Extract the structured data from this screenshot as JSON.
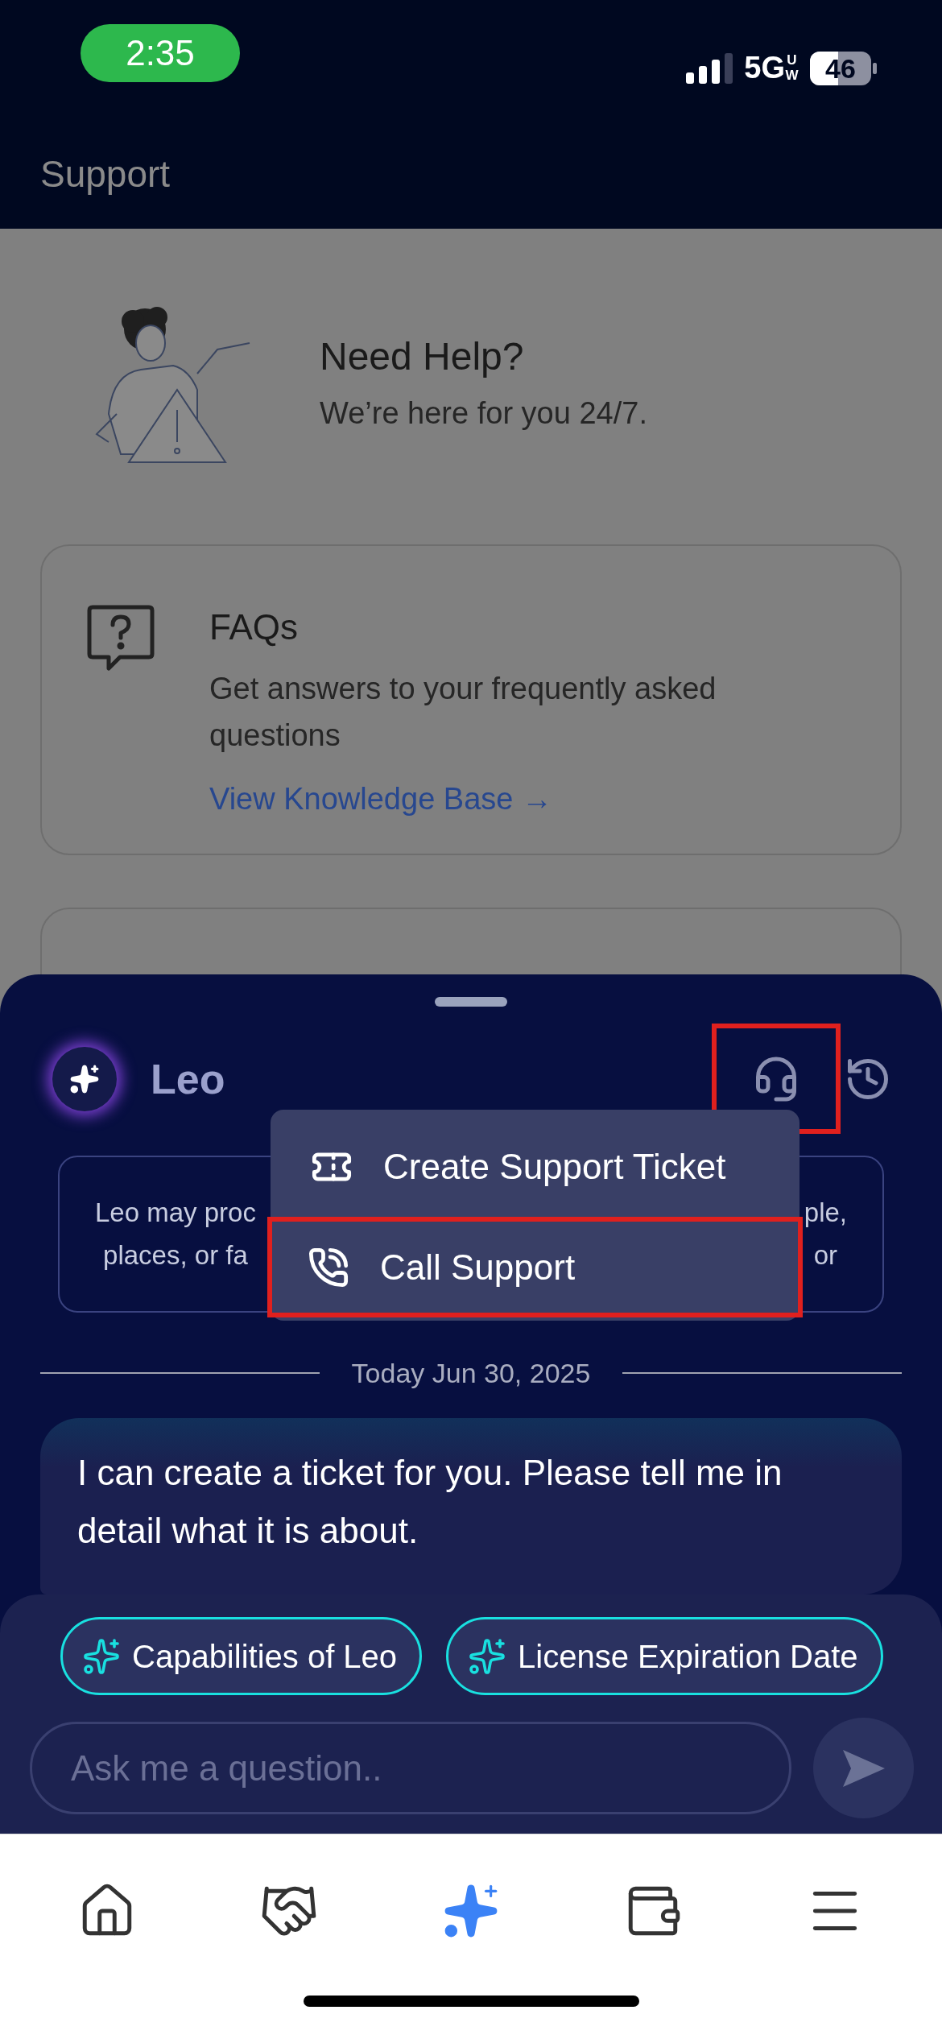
{
  "status_bar": {
    "time": "2:35",
    "network": "5G",
    "network_sub": "UW",
    "battery": "46"
  },
  "header": {
    "title": "Support"
  },
  "hero": {
    "title": "Need Help?",
    "subtitle": "We’re here for you 24/7."
  },
  "cards": [
    {
      "kind": "faq",
      "title": "FAQs",
      "description": "Get answers to your frequently asked questions",
      "link": "View Knowledge Base",
      "link_arrow": "→"
    },
    {
      "kind": "blank"
    }
  ],
  "assistant": {
    "name": "Leo",
    "support_button_highlighted": true,
    "disclaimer": {
      "left": [
        "Leo may proc",
        "places, or fa"
      ],
      "right": [
        "ple,",
        "or"
      ]
    },
    "menu": [
      {
        "label": "Create Support Ticket",
        "highlighted": false
      },
      {
        "label": "Call Support",
        "highlighted": true
      }
    ],
    "date": "Today Jun 30, 2025",
    "messages": [
      {
        "text": "I can create a ticket for you. Please tell me in detail what it is about."
      }
    ],
    "suggestions": [
      "Capabilities of Leo",
      "License Expiration Date"
    ],
    "input": {
      "placeholder": "Ask me a question.."
    }
  },
  "nav": [
    {
      "selected": false
    },
    {
      "selected": false
    },
    {
      "selected": true
    },
    {
      "selected": false
    },
    {
      "selected": false
    }
  ]
}
